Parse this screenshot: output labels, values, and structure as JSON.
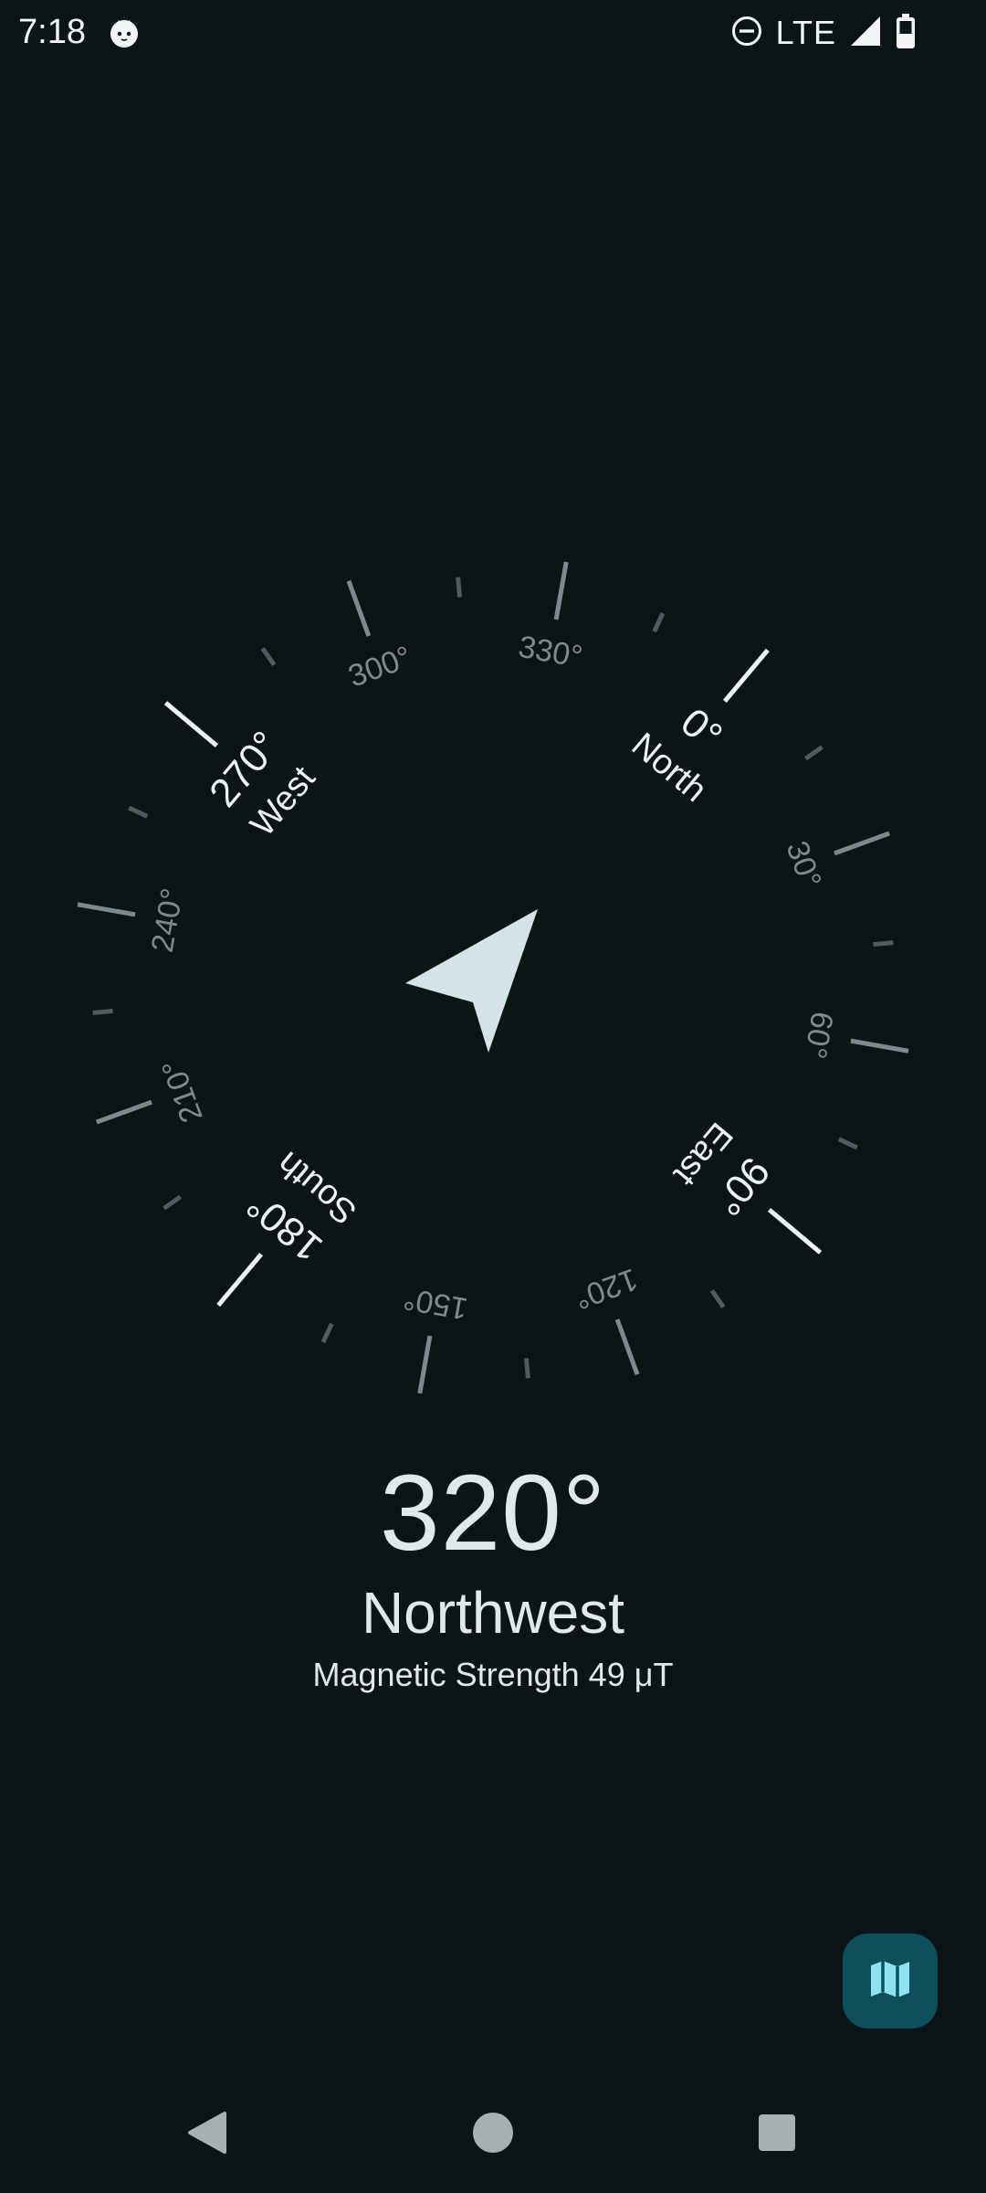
{
  "status_bar": {
    "time": "7:18",
    "app_icon": "cat-face-icon",
    "dnd_icon": "do-not-disturb-icon",
    "network": "LTE",
    "signal_icon": "cellular-signal-icon",
    "battery_icon": "battery-icon"
  },
  "compass": {
    "heading_deg": 320,
    "cardinals": [
      {
        "key": "north",
        "deg": 0,
        "label": "North",
        "degree_label": "0°"
      },
      {
        "key": "east",
        "deg": 90,
        "label": "East",
        "degree_label": "90°"
      },
      {
        "key": "south",
        "deg": 180,
        "label": "South",
        "degree_label": "180°"
      },
      {
        "key": "west",
        "deg": 270,
        "label": "West",
        "degree_label": "270°"
      }
    ],
    "minor_degree_labels": [
      {
        "deg": 30,
        "label": "30°"
      },
      {
        "deg": 60,
        "label": "60°"
      },
      {
        "deg": 120,
        "label": "120°"
      },
      {
        "deg": 150,
        "label": "150°"
      },
      {
        "deg": 210,
        "label": "210°"
      },
      {
        "deg": 240,
        "label": "240°"
      },
      {
        "deg": 300,
        "label": "300°"
      },
      {
        "deg": 330,
        "label": "330°"
      }
    ],
    "arrow_icon": "navigation-arrow-icon"
  },
  "readout": {
    "heading": "320°",
    "direction": "Northwest",
    "magnetic": "Magnetic Strength 49 μT"
  },
  "fab": {
    "icon": "map-icon"
  },
  "nav": {
    "back_icon": "back-triangle-icon",
    "home_icon": "home-circle-icon",
    "recents_icon": "recents-square-icon"
  },
  "colors": {
    "background": "#0b1517",
    "fab": "#0d5059",
    "fab_icon": "#8fe3f0",
    "text": "#dfe8ea"
  }
}
